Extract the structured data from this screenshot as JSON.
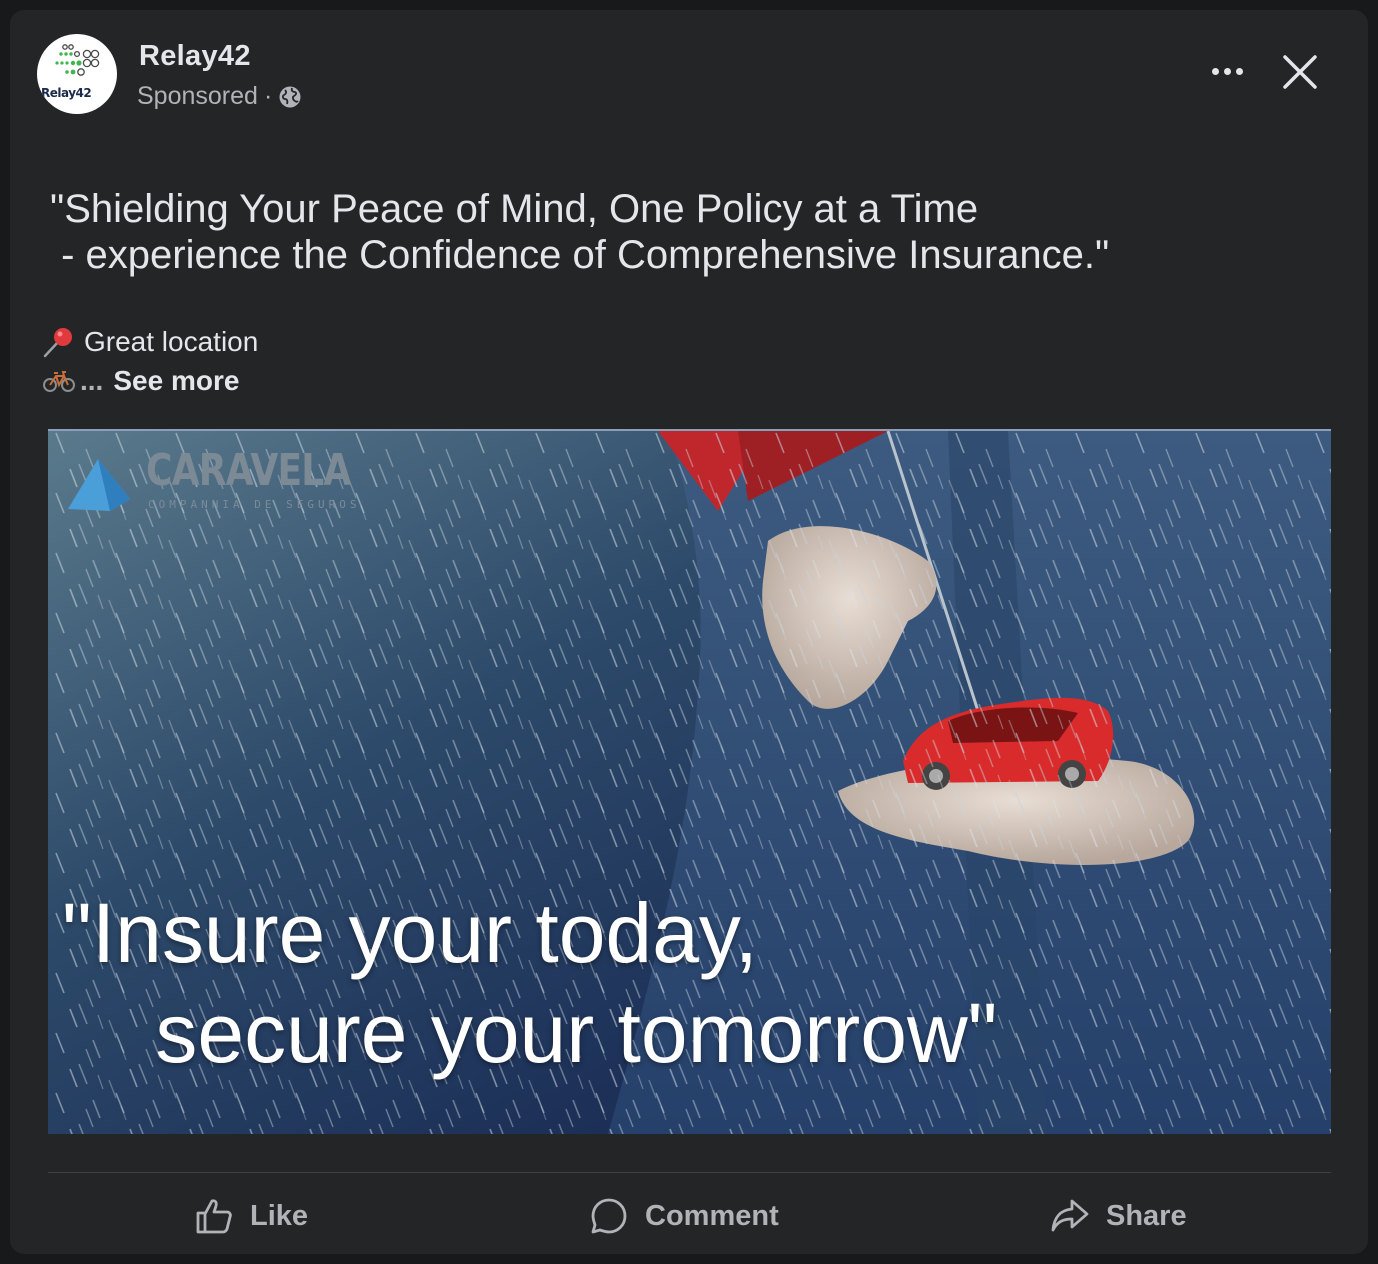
{
  "post": {
    "page_name": "Relay42",
    "sponsored_label": "Sponsored",
    "separator": "·",
    "avatar_text": "Relay42",
    "body_text": "\"Shielding Your Peace of Mind, One Policy at a Time\n - experience the Confidence of Comprehensive Insurance.\"",
    "location_line": "Great location",
    "ellipsis": "...",
    "see_more": "See more"
  },
  "ad_image": {
    "brand_name": "CARAVELA",
    "brand_subtitle": "COMPANHIA DE SEGUROS",
    "slogan": "\"Insure your today,\n    secure your tomorrow\""
  },
  "actions": {
    "like": "Like",
    "comment": "Comment",
    "share": "Share"
  },
  "icons": {
    "menu": "more-horizontal-icon",
    "close": "close-icon",
    "privacy": "globe-icon",
    "location": "round-pushpin-icon",
    "bike": "bicycle-icon",
    "like": "thumbs-up-icon",
    "comment": "comment-icon",
    "share": "share-arrow-icon"
  },
  "colors": {
    "card_bg": "#242526",
    "page_bg": "#18191a",
    "primary_text": "#e4e6eb",
    "secondary_text": "#b0b3b8",
    "brand_logo": "#4a9fd8"
  }
}
